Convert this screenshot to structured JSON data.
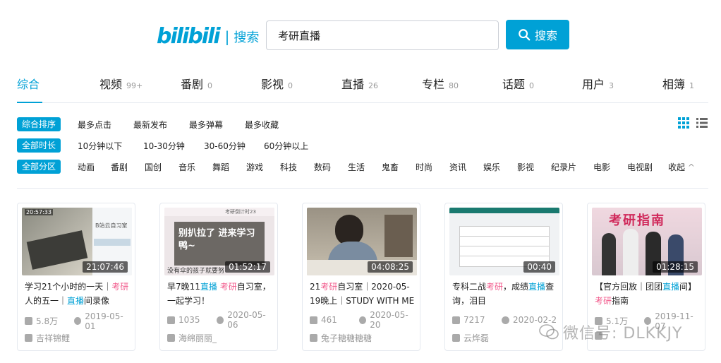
{
  "header": {
    "logo": "bilibili",
    "logo_sub": "搜索",
    "search_value": "考研直播",
    "search_button": "搜索"
  },
  "tabs": [
    {
      "label": "综合",
      "count": ""
    },
    {
      "label": "视频",
      "count": "99+"
    },
    {
      "label": "番剧",
      "count": "0"
    },
    {
      "label": "影视",
      "count": "0"
    },
    {
      "label": "直播",
      "count": "26"
    },
    {
      "label": "专栏",
      "count": "80"
    },
    {
      "label": "话题",
      "count": "0"
    },
    {
      "label": "用户",
      "count": "3"
    },
    {
      "label": "相簿",
      "count": "1"
    }
  ],
  "filters": {
    "sort": {
      "pill": "综合排序",
      "options": [
        "最多点击",
        "最新发布",
        "最多弹幕",
        "最多收藏"
      ]
    },
    "duration": {
      "pill": "全部时长",
      "options": [
        "10分钟以下",
        "10-30分钟",
        "30-60分钟",
        "60分钟以上"
      ]
    },
    "zone": {
      "pill": "全部分区",
      "options": [
        "动画",
        "番剧",
        "国创",
        "音乐",
        "舞蹈",
        "游戏",
        "科技",
        "数码",
        "生活",
        "鬼畜",
        "时尚",
        "资讯",
        "娱乐",
        "影视",
        "纪录片",
        "电影",
        "电视剧",
        "收起"
      ]
    }
  },
  "cards": [
    {
      "duration": "21:07:46",
      "title_parts": [
        [
          "学习21个小时的一天｜",
          ""
        ],
        [
          "考研",
          "hl"
        ],
        [
          "人的五一｜",
          ""
        ],
        [
          "直播",
          "hl"
        ],
        [
          "间录像",
          ""
        ]
      ],
      "plays": "5.8万",
      "date": "2019-05-01",
      "uploader": "吉祥锦鲤",
      "thumb_time": "20:57:33",
      "thumb_text": "B站云自习室"
    },
    {
      "duration": "01:52:17",
      "title_parts": [
        [
          "早7晚11",
          ""
        ],
        [
          "直播",
          "hl"
        ],
        [
          " ",
          ""
        ],
        [
          "考研",
          "hl"
        ],
        [
          "自习室，一起学习！",
          ""
        ]
      ],
      "plays": "1035",
      "date": "2020-05-06",
      "uploader": "海绵丽丽_",
      "thumb_top": "考研倒计时23",
      "thumb_text": "别扒拉了 进来学习鸭~",
      "thumb_bottom": "没有伞的孩子就要努"
    },
    {
      "duration": "04:08:25",
      "title_parts": [
        [
          "21",
          ""
        ],
        [
          "考研",
          "hl"
        ],
        [
          "自习室｜2020-05-19晚上｜STUDY WITH ME",
          ""
        ]
      ],
      "plays": "461",
      "date": "2020-05-20",
      "uploader": "兔子糖糖糖糖"
    },
    {
      "duration": "00:40",
      "title_parts": [
        [
          "专科二战",
          ""
        ],
        [
          "考研",
          "hl"
        ],
        [
          "，成绩",
          ""
        ],
        [
          "直播",
          "hl"
        ],
        [
          "查询，泪目",
          ""
        ]
      ],
      "plays": "7217",
      "date": "2020-02-2",
      "uploader": "云烨磊"
    },
    {
      "duration": "01:28:15",
      "title_parts": [
        [
          "【官方回放｜团团",
          ""
        ],
        [
          "直播",
          "hl"
        ],
        [
          "间】",
          ""
        ],
        [
          "考研",
          "hl"
        ],
        [
          "指南",
          ""
        ]
      ],
      "plays": "5.1万",
      "date": "2019-11-07",
      "uploader": "",
      "thumb_text": "考研指南"
    }
  ],
  "watermark": "微信号: DLKKJY",
  "colors": {
    "accent": "#00a1d6",
    "highlight": "#f25d8e"
  }
}
